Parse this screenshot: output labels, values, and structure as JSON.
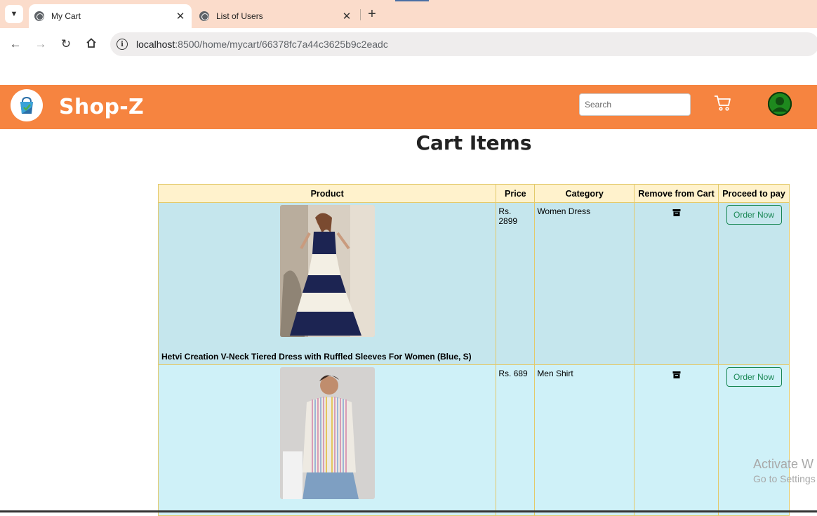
{
  "browser": {
    "tabs": [
      {
        "title": "My Cart",
        "active": true
      },
      {
        "title": "List of Users",
        "active": false
      }
    ],
    "url_host": "localhost",
    "url_rest": ":8500/home/mycart/66378fc7a44c3625b9c2eadc",
    "icons": {
      "back": "back-arrow-icon",
      "forward": "forward-arrow-icon",
      "reload": "reload-icon",
      "home": "home-icon",
      "info": "info-icon"
    }
  },
  "header": {
    "brand": "Shop-Z",
    "search_placeholder": "Search",
    "bg_color": "#f68440",
    "user_icon_color": "#1e8a1e"
  },
  "main": {
    "title": "Cart Items",
    "columns": [
      "Product",
      "Price",
      "Category",
      "Remove from Cart",
      "Proceed to pay"
    ],
    "items": [
      {
        "name": "Hetvi Creation V-Neck Tiered Dress with Ruffled Sleeves For Women (Blue, S)",
        "price": "Rs. 2899",
        "category": "Women Dress",
        "order_label": "Order Now"
      },
      {
        "name": "",
        "price": "Rs. 689",
        "category": "Men Shirt",
        "order_label": "Order Now"
      }
    ]
  },
  "watermark": {
    "line1": "Activate W",
    "line2": "Go to Settings"
  }
}
